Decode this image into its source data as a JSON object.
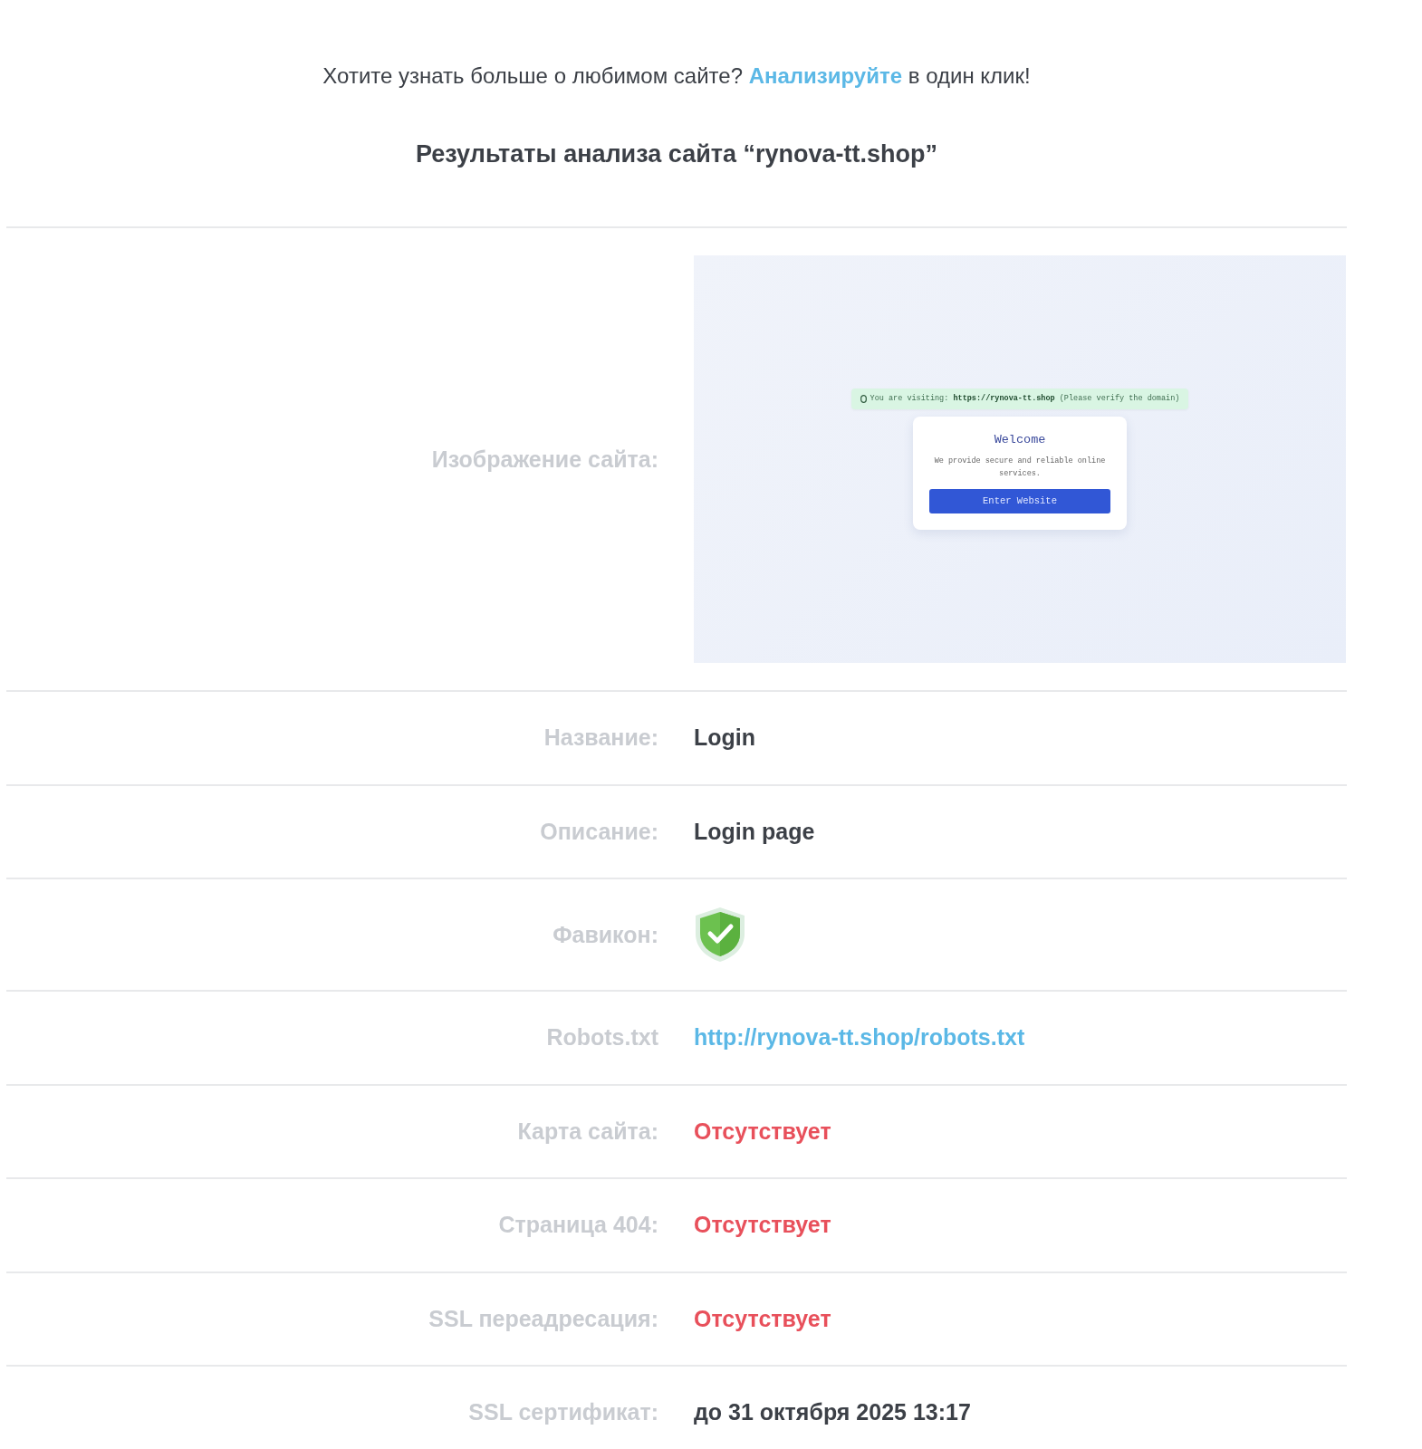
{
  "intro": {
    "before": "Хотите узнать больше о любимом сайте? ",
    "link": "Анализируйте",
    "after": " в один клик!"
  },
  "title": "Результаты анализа сайта “rynova-tt.shop”",
  "rows": [
    {
      "label": "Изображение сайта:",
      "kind": "screenshot",
      "shot": {
        "notice": "You are visiting: **https://rynova-tt.shop** (Please verify the domain)",
        "heading": "Welcome",
        "text": "We provide secure and reliable online services.",
        "button": "Enter Website"
      }
    },
    {
      "label": "Название:",
      "kind": "text",
      "value": "Login"
    },
    {
      "label": "Описание:",
      "kind": "text",
      "value": "Login page"
    },
    {
      "label": "Фавикон:",
      "kind": "favicon"
    },
    {
      "label": "Robots.txt",
      "kind": "link",
      "value": "http://rynova-tt.shop/robots.txt"
    },
    {
      "label": "Карта сайта:",
      "kind": "missing",
      "value": "Отсутствует"
    },
    {
      "label": "Страница 404:",
      "kind": "missing",
      "value": "Отсутствует"
    },
    {
      "label": "SSL переадресация:",
      "kind": "missing",
      "value": "Отсутствует"
    },
    {
      "label": "SSL сертификат:",
      "kind": "text",
      "value": "до 31 октября 2025 13:17"
    }
  ]
}
